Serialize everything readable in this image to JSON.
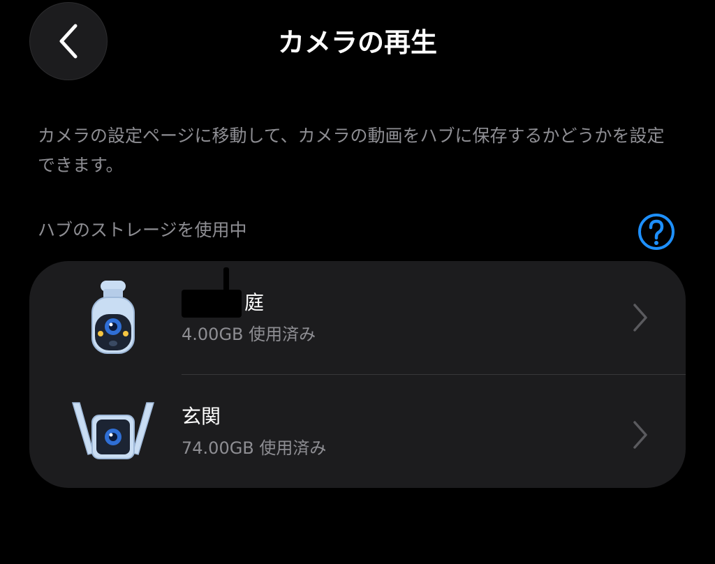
{
  "header": {
    "title": "カメラの再生",
    "back_icon": "chevron-left-icon"
  },
  "description": "カメラの設定ページに移動して、カメラの動画をハブに保存するかどうかを設定できます。",
  "storage_section": {
    "label": "ハブのストレージを使用中",
    "help_icon": "question-circle-icon",
    "accent_color": "#1e90ff",
    "devices": [
      {
        "name": "庭",
        "usage": "4.00GB 使用済み",
        "icon": "bullet-camera-icon",
        "name_partially_redacted": true
      },
      {
        "name": "玄関",
        "usage": "74.00GB 使用済み",
        "icon": "antenna-camera-icon"
      }
    ]
  },
  "colors": {
    "background": "#000000",
    "card": "#1c1c1e",
    "secondary_text": "#8e8e93",
    "camera_body": "#c9ddf3",
    "camera_lens": "#2f6fd6"
  }
}
